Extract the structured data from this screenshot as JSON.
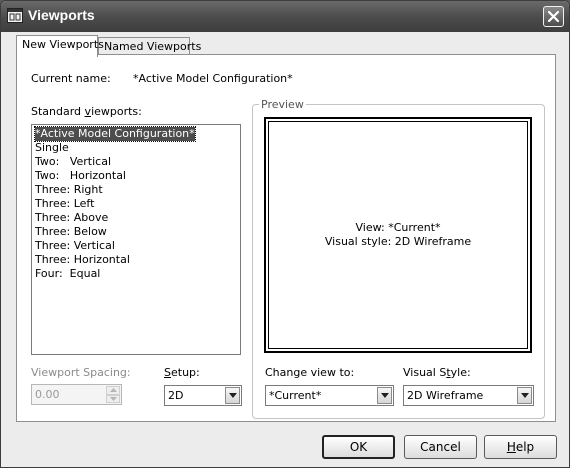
{
  "window": {
    "title": "Viewports"
  },
  "tabs": [
    {
      "label": "New Viewports",
      "active": true
    },
    {
      "label": "Named Viewports",
      "active": false
    }
  ],
  "current_name": {
    "label": "Current name:",
    "value": "*Active Model Configuration*"
  },
  "standard_viewports": {
    "label": "Standard viewports:",
    "items": [
      "*Active Model Configuration*",
      "Single",
      "Two:   Vertical",
      "Two:   Horizontal",
      "Three: Right",
      "Three: Left",
      "Three: Above",
      "Three: Below",
      "Three: Vertical",
      "Three: Horizontal",
      "Four:  Equal"
    ],
    "selected_index": 0
  },
  "preview": {
    "label": "Preview",
    "view_line": "View: *Current*",
    "style_line": "Visual style: 2D Wireframe"
  },
  "viewport_spacing": {
    "label": "Viewport Spacing:",
    "value": "0.00",
    "enabled": false
  },
  "setup": {
    "label": "Setup:",
    "value": "2D"
  },
  "change_view_to": {
    "label": "Change view to:",
    "value": "*Current*"
  },
  "visual_style": {
    "label": "Visual Style:",
    "value": "2D Wireframe"
  },
  "buttons": {
    "ok": "OK",
    "cancel": "Cancel",
    "help": "Help"
  },
  "colors": {
    "titlebar": "#4a4a4a",
    "dialog_background": "#ececec",
    "panel_background": "#ffffff",
    "selection": "#4d4d4d"
  }
}
